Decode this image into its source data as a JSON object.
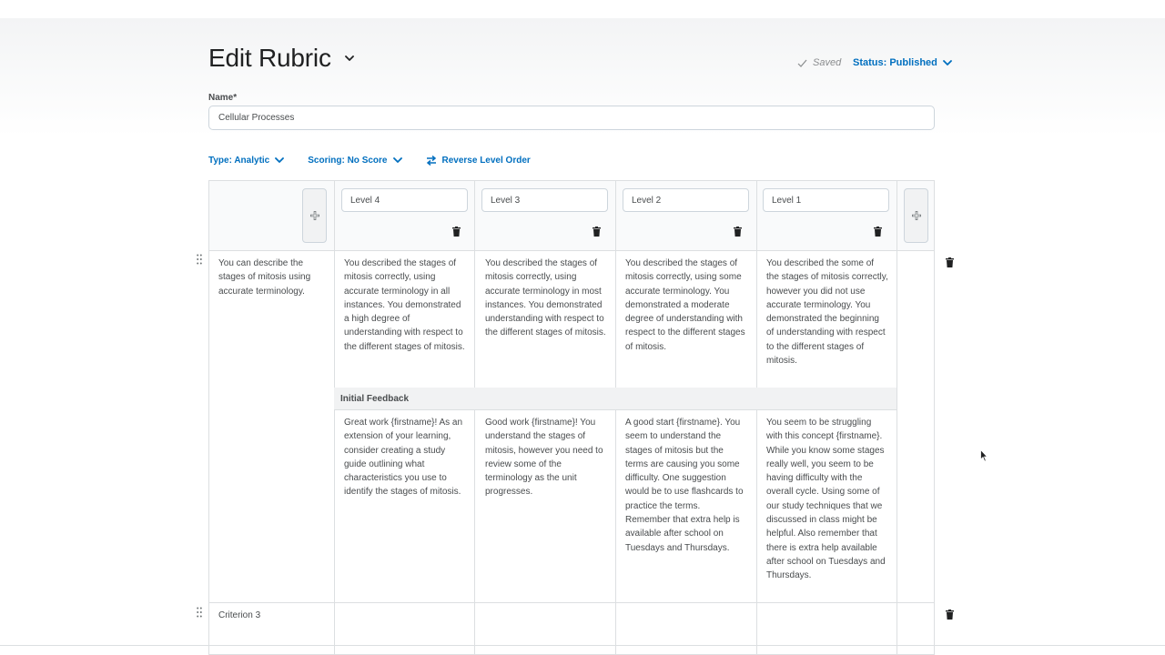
{
  "header": {
    "title": "Edit Rubric",
    "saved": "Saved",
    "status": "Status: Published"
  },
  "name_field": {
    "label": "Name*",
    "value": "Cellular Processes"
  },
  "toolbar": {
    "type": "Type: Analytic",
    "scoring": "Scoring: No Score",
    "reverse": "Reverse Level Order"
  },
  "levels": [
    "Level 4",
    "Level 3",
    "Level 2",
    "Level 1"
  ],
  "criteria": [
    {
      "name": "You can describe the stages of mitosis using accurate terminology.",
      "descriptions": [
        "You described the stages of mitosis correctly, using accurate terminology in all instances.  You demonstrated a high degree of understanding with respect to the different stages of mitosis.",
        "You described the stages of mitosis correctly, using accurate terminology in most instances.  You demonstrated understanding with respect to the different stages of mitosis.",
        "You described the stages of mitosis correctly, using some accurate terminology.  You demonstrated a moderate degree of understanding with respect to the different stages of mitosis.",
        "You described the some of the stages of mitosis correctly, however you did not use accurate terminology.  You demonstrated the beginning of understanding with respect to the different stages of mitosis."
      ],
      "feedback_label": "Initial Feedback",
      "feedback": [
        "Great work {firstname}!  As an extension of your learning, consider creating a study guide outlining what characteristics you use to identify the stages of mitosis.",
        "Good work {firstname}!  You understand the stages of mitosis, however you need to review some of the terminology as the unit progresses.",
        "A good start {firstname}.  You seem to understand the stages of mitosis but the terms are causing you some difficulty.  One suggestion would be to use flashcards to practice the terms.  Remember that extra help is available after school on Tuesdays and Thursdays.",
        "You seem to be struggling with this concept {firstname}.  While you know some stages really well, you seem to be having difficulty with the overall cycle.  Using some of our study techniques that we discussed in class might be helpful.  Also remember that there is extra help available after school on Tuesdays and Thursdays."
      ]
    },
    {
      "name": "Criterion 3"
    }
  ],
  "icons": {
    "add": "plus-icon",
    "delete": "trash-icon",
    "drag": "drag-handle-icon",
    "reverse": "swap-arrows-icon"
  },
  "colors": {
    "link": "#006fbf",
    "border": "#dcdfe1",
    "text": "#494c4e"
  }
}
